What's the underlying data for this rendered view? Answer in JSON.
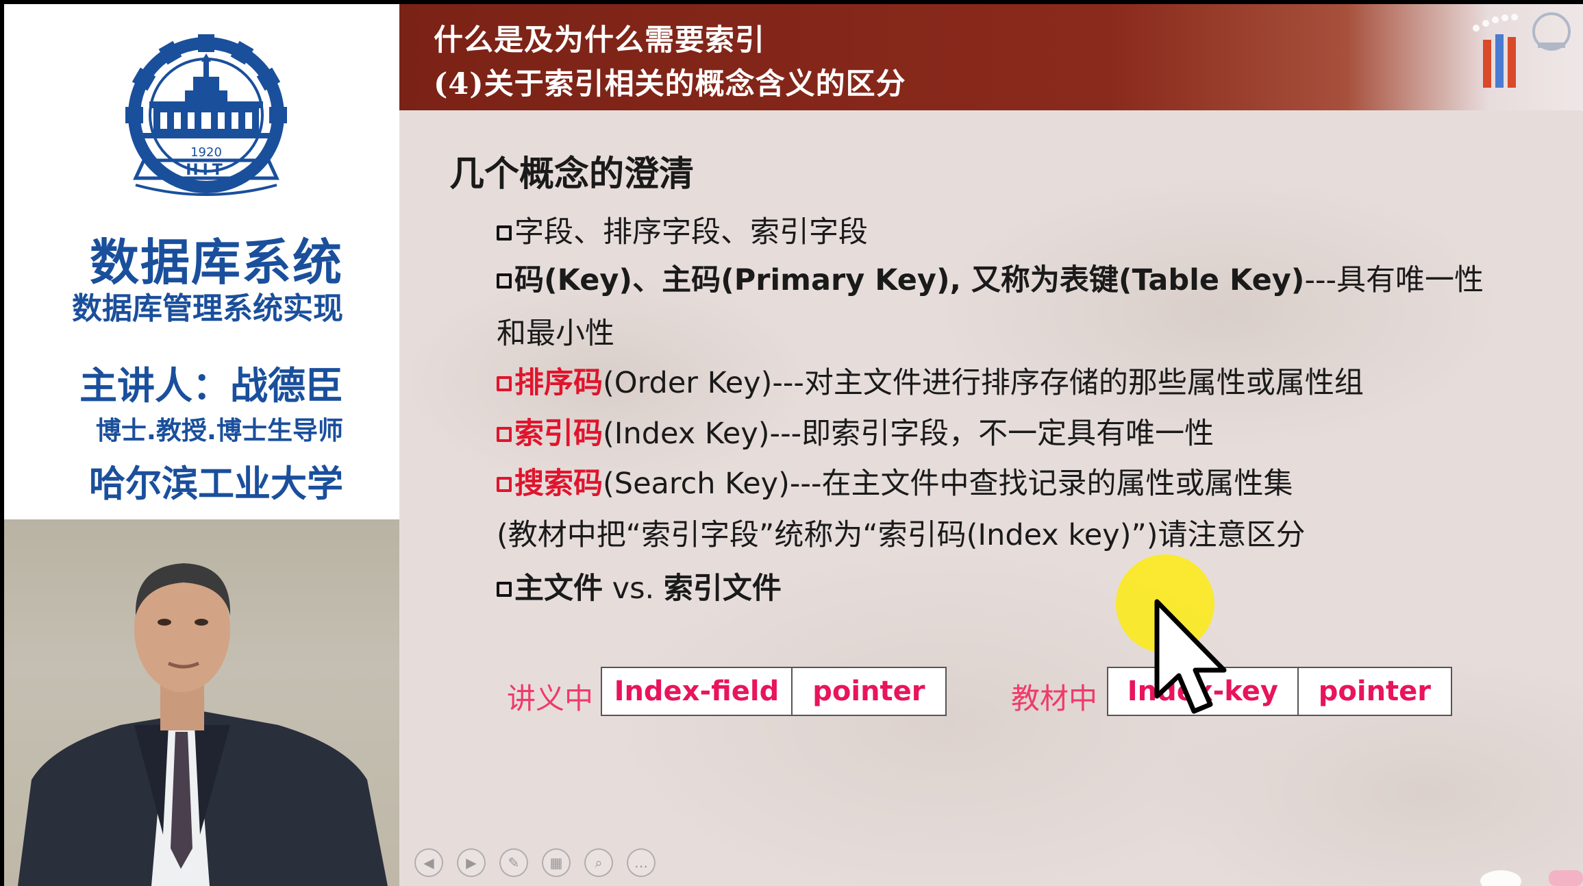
{
  "left_panel": {
    "logo": {
      "year": "1920",
      "initials": "HIT"
    },
    "course_title": "数据库系统",
    "course_subtitle": "数据库管理系统实现",
    "lecturer_name": "主讲人：战德臣",
    "lecturer_title": "博士.教授.博士生导师",
    "university_name": "哈尔滨工业大学"
  },
  "slide": {
    "header_title": "什么是及为什么需要索引",
    "header_subtitle": "(4)关于索引相关的概念含义的区分",
    "section_heading": "几个概念的澄清",
    "bullet_1": "字段、排序字段、索引字段",
    "bullet_2_bold": "码(Key)、主码(Primary Key), 又称为表键(Table Key)",
    "bullet_2_rest": "---具有唯一性",
    "bullet_2_cont": "和最小性",
    "bullet_3_term": "排序码",
    "bullet_3_rest": "(Order Key)---对主文件进行排序存储的那些属性或属性组",
    "bullet_4_term": "索引码",
    "bullet_4_rest": "(Index Key)---即索引字段，不一定具有唯一性",
    "bullet_5_term": "搜索码",
    "bullet_5_rest": "(Search Key)---在主文件中查找记录的属性或属性集",
    "note": "(教材中把“索引字段”统称为“索引码(Index key)”)请注意区分",
    "bullet_6_a": "主文件",
    "bullet_6_vs": " vs. ",
    "bullet_6_b": "索引文件",
    "lecture_label": "讲义中",
    "lecture_cells": [
      "Index-field",
      "pointer"
    ],
    "textbook_label": "教材中",
    "textbook_cells": [
      "Index-key",
      "pointer"
    ],
    "toolbar_icons": [
      "prev-icon",
      "next-icon",
      "pen-icon",
      "grid-icon",
      "zoom-icon",
      "more-icon"
    ]
  },
  "colors": {
    "header_bg": "#7b2216",
    "left_text_blue": "#1a4f9c",
    "term_red": "#e0142d",
    "cell_text_pink": "#e8145c",
    "label_pink": "#ef3a6a",
    "pointer_yellow": "#ffec00"
  }
}
